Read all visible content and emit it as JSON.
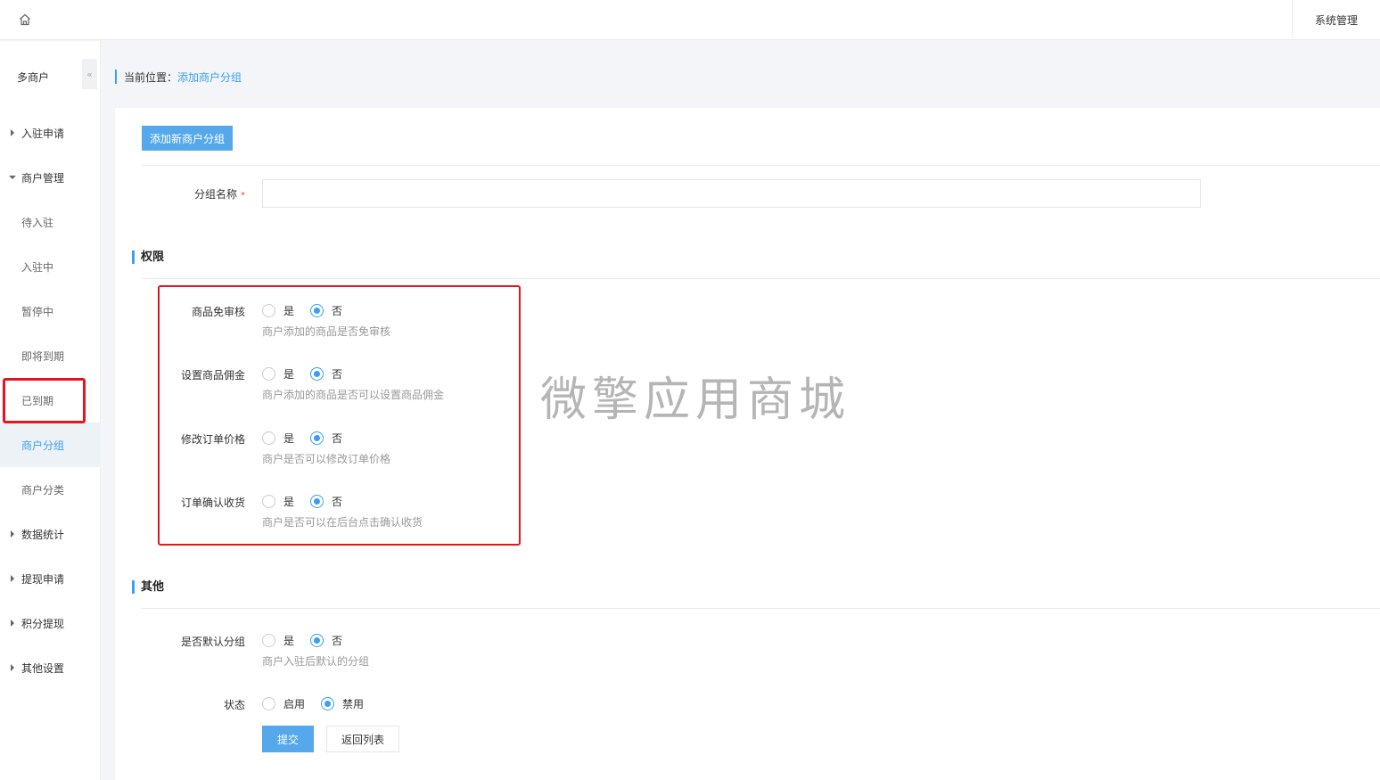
{
  "topbar": {
    "home_icon": "home-icon",
    "system_label": "系统管理"
  },
  "sidebar": {
    "title": "多商户",
    "collapse_glyph": "«",
    "items": [
      {
        "label": "入驻申请",
        "type": "group",
        "expanded": false
      },
      {
        "label": "商户管理",
        "type": "group",
        "expanded": true
      },
      {
        "label": "待入驻",
        "type": "sub"
      },
      {
        "label": "入驻中",
        "type": "sub"
      },
      {
        "label": "暂停中",
        "type": "sub"
      },
      {
        "label": "即将到期",
        "type": "sub"
      },
      {
        "label": "已到期",
        "type": "sub"
      },
      {
        "label": "商户分组",
        "type": "sub",
        "active": true
      },
      {
        "label": "商户分类",
        "type": "sub"
      },
      {
        "label": "数据统计",
        "type": "group",
        "expanded": false
      },
      {
        "label": "提现申请",
        "type": "group",
        "expanded": false
      },
      {
        "label": "积分提现",
        "type": "group",
        "expanded": false
      },
      {
        "label": "其他设置",
        "type": "group",
        "expanded": false
      }
    ]
  },
  "breadcrumb": {
    "label": "当前位置：",
    "current": "添加商户分组"
  },
  "form": {
    "add_button": "添加新商户分组",
    "name_label": "分组名称",
    "required_mark": "*",
    "name_value": "",
    "permissions_title": "权限",
    "permissions": [
      {
        "label": "商品免审核",
        "yes": "是",
        "no": "否",
        "selected": "no",
        "hint": "商户添加的商品是否免审核"
      },
      {
        "label": "设置商品佣金",
        "yes": "是",
        "no": "否",
        "selected": "no",
        "hint": "商户添加的商品是否可以设置商品佣金"
      },
      {
        "label": "修改订单价格",
        "yes": "是",
        "no": "否",
        "selected": "no",
        "hint": "商户是否可以修改订单价格"
      },
      {
        "label": "订单确认收货",
        "yes": "是",
        "no": "否",
        "selected": "no",
        "hint": "商户是否可以在后台点击确认收货"
      }
    ],
    "other_title": "其他",
    "default_group": {
      "label": "是否默认分组",
      "yes": "是",
      "no": "否",
      "selected": "no",
      "hint": "商户入驻后默认的分组"
    },
    "status": {
      "label": "状态",
      "enable": "启用",
      "disable": "禁用",
      "selected": "disable"
    },
    "submit": "提交",
    "back": "返回列表"
  },
  "watermark": "微擎应用商城",
  "colors": {
    "accent": "#3a9ff0",
    "highlight_border": "#e8141c",
    "button": "#55a8ea"
  }
}
